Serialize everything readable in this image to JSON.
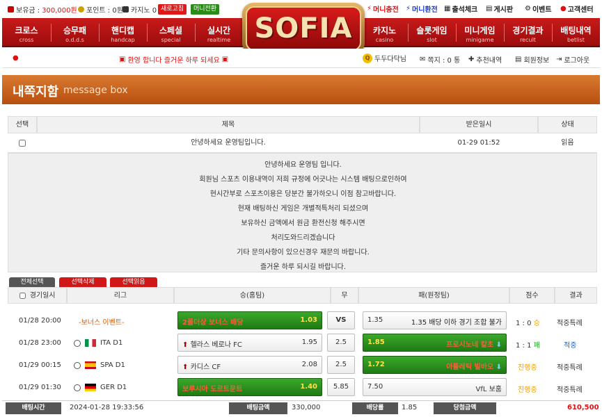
{
  "topbar": {
    "balance_label": "보유금 :",
    "balance_value": "300,000원",
    "point_label": "포인트 : 0원",
    "casino_label": "카지노 0",
    "refresh_btn": "새로고침",
    "transfer_btn": "머니전환",
    "right": [
      "머니충전",
      "머니환전",
      "출석체크",
      "게시판",
      "이벤트",
      "고객센터"
    ]
  },
  "nav": {
    "left": [
      {
        "ko": "크로스",
        "en": "cross"
      },
      {
        "ko": "승무패",
        "en": "o.d.d.s"
      },
      {
        "ko": "핸디캡",
        "en": "handcap"
      },
      {
        "ko": "스페셜",
        "en": "special"
      },
      {
        "ko": "실시간",
        "en": "realtime"
      }
    ],
    "right": [
      {
        "ko": "카지노",
        "en": "casino"
      },
      {
        "ko": "슬롯게임",
        "en": "slot"
      },
      {
        "ko": "미니게임",
        "en": "minigame"
      },
      {
        "ko": "경기결과",
        "en": "recult"
      },
      {
        "ko": "배팅내역",
        "en": "betlist"
      }
    ]
  },
  "logo": "SOFIA",
  "infobar": {
    "marquee": "환영 합니다 즐거운 하루 되세요",
    "username": "두두다닥님",
    "notes": "쪽지 : 0 통",
    "referral": "추천내역",
    "member_info": "회원정보",
    "logout": "로그아웃"
  },
  "page_title": {
    "ko": "내쪽지함",
    "en": "message box"
  },
  "msg_table": {
    "headers": [
      "선택",
      "제목",
      "받은일시",
      "상태"
    ],
    "row": {
      "title": "안녕하세요 운영팀입니다.",
      "date": "01-29 01:52",
      "status": "읽음"
    },
    "body": [
      "안녕하세요 운영팀 입니다.",
      "회원님 스포츠 이용내역이 저희 규정에 어긋나는 시스템 배팅으로인하여",
      "현시간부로 스포츠이용은 당분간 불가하오니 이점 참고바랍니다.",
      "현재 배팅하신 게임은 개별적특처리 되셨으며",
      "보유하신 금액에서 원금 환전신청 해주시면",
      "처리도와드리겠습니다",
      "기타 문의사항이 있으신경우 재문의 바랍니다.",
      "즐거운 하루 되시길 바랍니다."
    ],
    "tab_buttons": [
      "전체선택",
      "선택삭제",
      "선택읽음"
    ]
  },
  "bet_table": {
    "headers": [
      "경기일시",
      "리그",
      "승(홈팀)",
      "무",
      "패(원정팀)",
      "점수",
      "결과"
    ],
    "rows": [
      {
        "date": "01/28 20:00",
        "league": "-보너스 이벤트-",
        "flag": "",
        "home": "2폴더상 보너스 배당",
        "home_odds": "1.03",
        "draw": "VS",
        "away": "1.35 배당 이하 경기 조합 불가",
        "away_odds": "1.35",
        "score": "1 : 0",
        "score_suffix": "승",
        "result": "적중특례",
        "sel": "home"
      },
      {
        "date": "01/28 23:00",
        "league": "ITA D1",
        "flag": "ita",
        "home": "헬라스 베로나 FC",
        "home_odds": "1.95",
        "draw": "2.5",
        "away": "프로시노네 칼초",
        "away_odds": "1.85",
        "score": "1 : 1",
        "score_suffix": "패",
        "result": "적중",
        "sel": "away"
      },
      {
        "date": "01/29 00:15",
        "league": "SPA D1",
        "flag": "spa",
        "home": "카디스 CF",
        "home_odds": "2.08",
        "draw": "2.5",
        "away": "아틀레틱 빌바오",
        "away_odds": "1.72",
        "score": "진행중",
        "score_suffix": "",
        "result": "적중특례",
        "sel": "away"
      },
      {
        "date": "01/29 01:30",
        "league": "GER D1",
        "flag": "ger",
        "home": "보루시아 도르트문트",
        "home_odds": "1.40",
        "draw": "5.85",
        "away": "VfL 보훔",
        "away_odds": "7.50",
        "score": "진행중",
        "score_suffix": "",
        "result": "적중특례",
        "sel": "home"
      }
    ]
  },
  "footer": {
    "bet_time_label": "배팅시간",
    "bet_time": "2024-01-28 19:33:56",
    "bet_amount_label": "배팅금액",
    "bet_amount": "330,000",
    "odds_label": "배당률",
    "odds": "1.85",
    "win_amount_label": "당첨금액",
    "win_amount": "610,500"
  },
  "colors": {
    "accent_red": "#c81a1a",
    "orange": "#d97a2f",
    "green": "#2e9322",
    "score_orange": "#e8a000",
    "score_green": "#2fae2f",
    "win_red": "#e01010"
  }
}
